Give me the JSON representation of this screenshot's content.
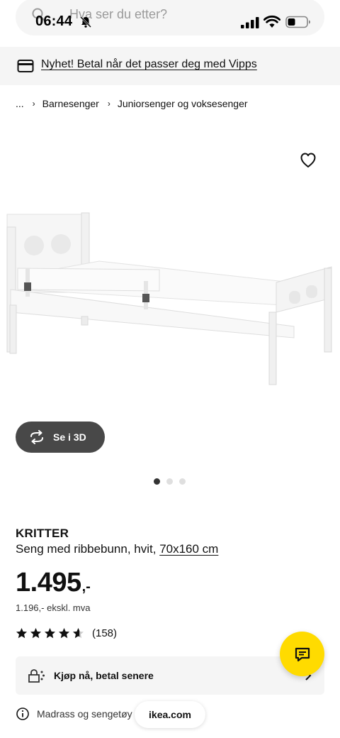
{
  "status_bar": {
    "time": "06:44"
  },
  "search": {
    "placeholder": "Hva ser du etter?"
  },
  "promo": {
    "text": "Nyhet! Betal når det passer deg med Vipps"
  },
  "breadcrumb": {
    "items": [
      "...",
      "Barnesenger",
      "Juniorsenger og voksesenger"
    ]
  },
  "gallery": {
    "view_3d_label": "Se i 3D",
    "slides": 3,
    "active_slide": 1
  },
  "product": {
    "name": "KRITTER",
    "description": "Seng med ribbebunn, hvit, ",
    "size": "70x160 cm",
    "price_main": "1.495",
    "price_suffix": ",-",
    "price_ex_vat": "1.196,- ekskl. mva",
    "rating": 4.6,
    "review_count": "(158)"
  },
  "payment": {
    "label": "Kjøp nå, betal senere"
  },
  "info": {
    "text": "Madrass og sengetøy s"
  },
  "browser": {
    "url": "ikea.com"
  },
  "colors": {
    "accent_yellow": "#ffdb00",
    "dark_button": "#484848",
    "banner_bg": "#f5f5f5"
  }
}
